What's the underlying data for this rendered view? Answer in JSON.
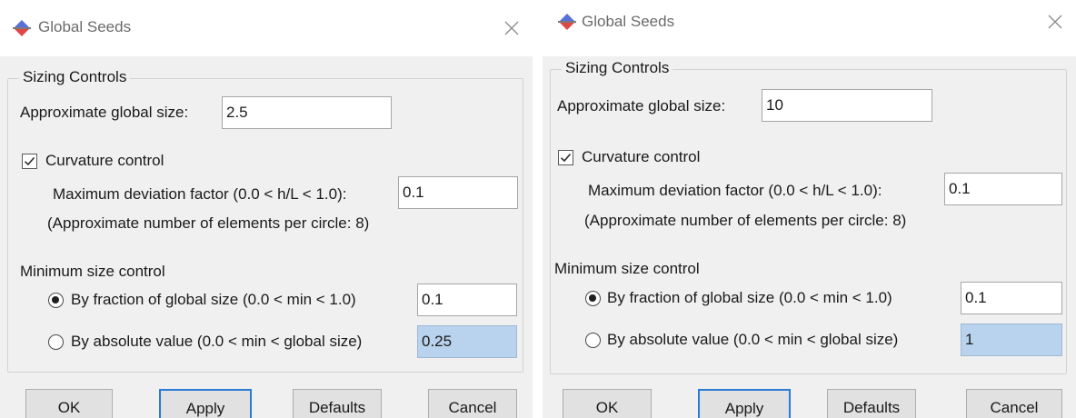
{
  "dialogs": [
    {
      "title": "Global Seeds",
      "sizing_group": "Sizing Controls",
      "global_size_label": "Approximate global size:",
      "global_size_value": "2.5",
      "curvature_checked": true,
      "curvature_label": "Curvature control",
      "deviation_label": "Maximum deviation factor (0.0 < h/L < 1.0):",
      "deviation_value": "0.1",
      "elements_note": "(Approximate number of elements per circle: 8)",
      "min_size_label": "Minimum size control",
      "fraction_selected": true,
      "fraction_label": "By fraction of global size  (0.0 < min < 1.0)",
      "fraction_value": "0.1",
      "absolute_selected": false,
      "absolute_label": "By absolute value  (0.0 < min < global size)",
      "absolute_value": "0.25",
      "buttons": {
        "ok": "OK",
        "apply": "Apply",
        "defaults": "Defaults",
        "cancel": "Cancel"
      }
    },
    {
      "title": "Global Seeds",
      "sizing_group": "Sizing Controls",
      "global_size_label": "Approximate global size:",
      "global_size_value": "10",
      "curvature_checked": true,
      "curvature_label": "Curvature control",
      "deviation_label": "Maximum deviation factor (0.0 < h/L < 1.0):",
      "deviation_value": "0.1",
      "elements_note": "(Approximate number of elements per circle: 8)",
      "min_size_label": "Minimum size control",
      "fraction_selected": true,
      "fraction_label": "By fraction of global size  (0.0 < min < 1.0)",
      "fraction_value": "0.1",
      "absolute_selected": false,
      "absolute_label": "By absolute value  (0.0 < min < global size)",
      "absolute_value": "1",
      "buttons": {
        "ok": "OK",
        "apply": "Apply",
        "defaults": "Defaults",
        "cancel": "Cancel"
      }
    }
  ],
  "colors": {
    "dialog_bg": "#f0f0f0",
    "titlebar_bg": "#ffffff",
    "disabled_field_bg": "#b9d3ee",
    "focus_border": "#2b7bd6",
    "app_icon_blue": "#5a6fd8",
    "app_icon_red": "#e04848"
  },
  "icons": {
    "app": "abaqus-app-icon",
    "close": "close-icon",
    "check": "checkmark-icon"
  }
}
